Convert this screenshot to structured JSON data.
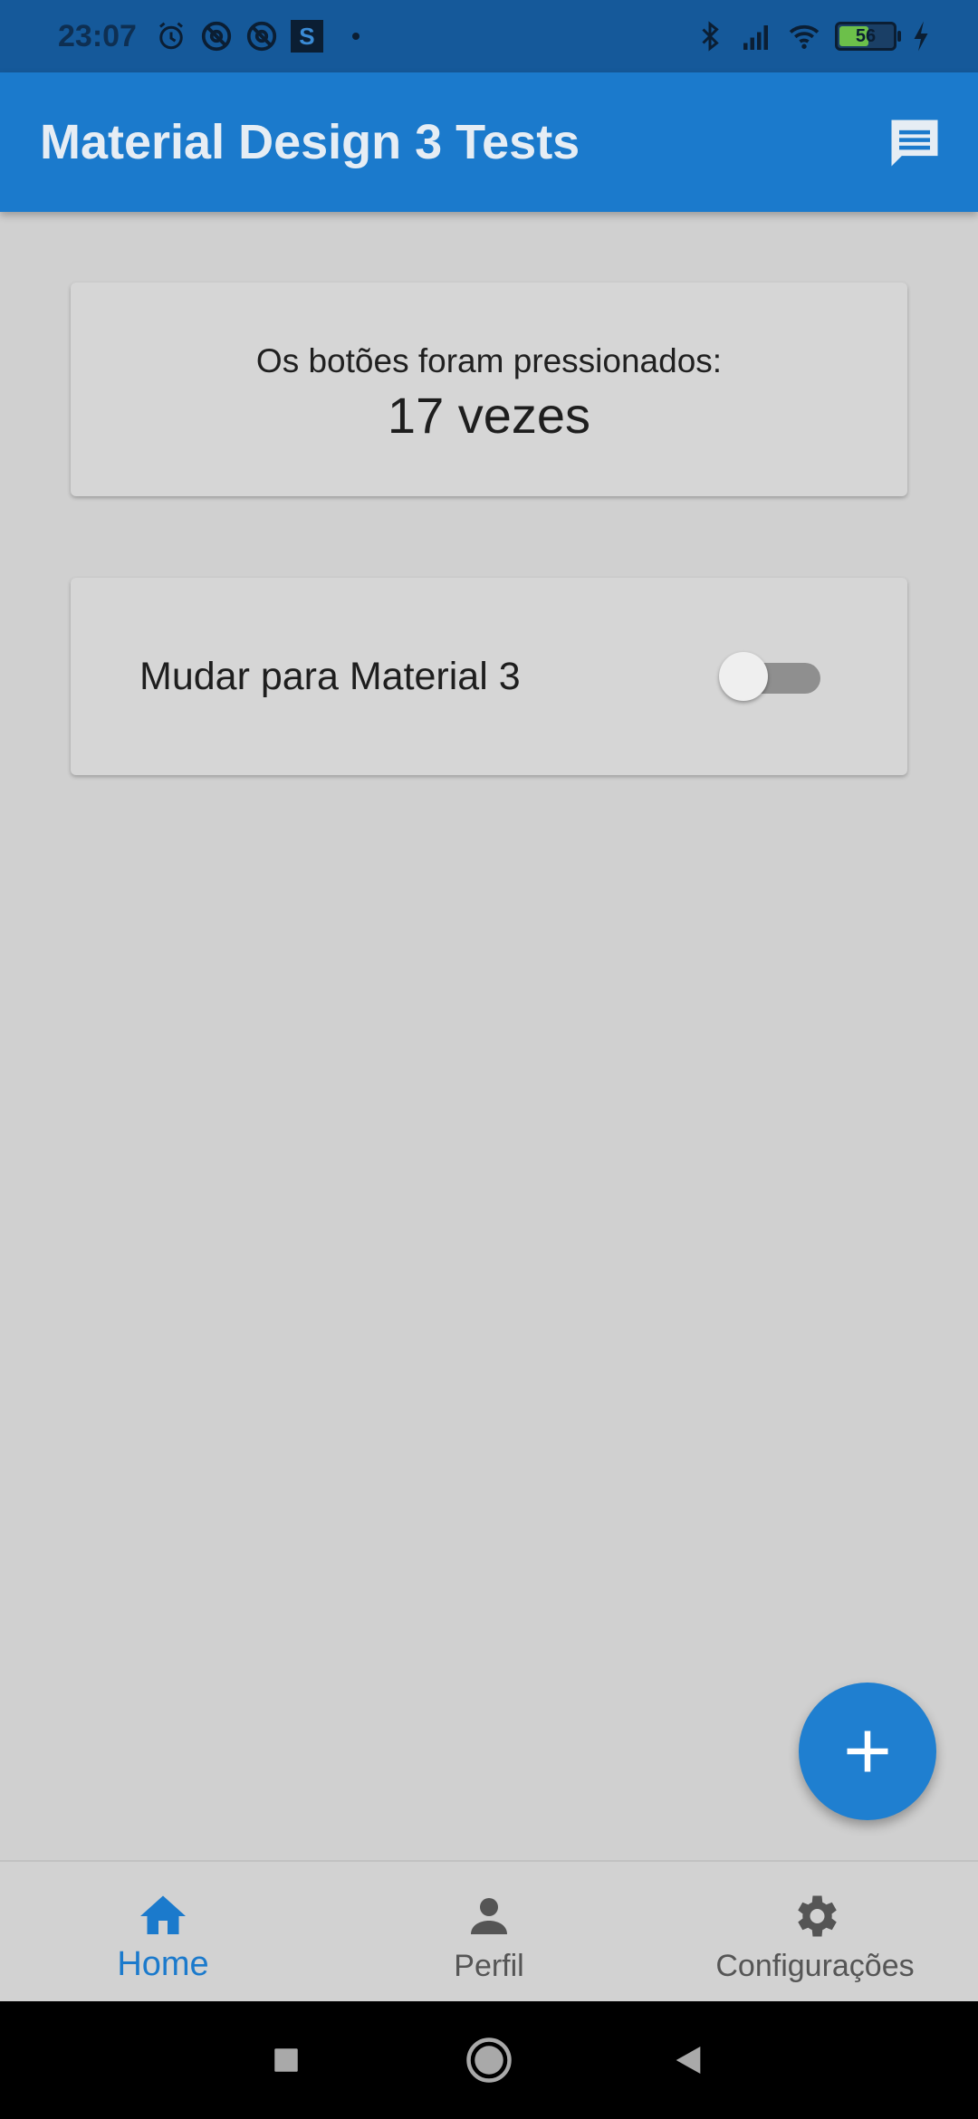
{
  "status_bar": {
    "time": "23:07",
    "left_icons": [
      "alarm-icon",
      "at-sign-icon",
      "at-sign-icon",
      "s-app-icon"
    ],
    "s_badge": "S",
    "right_icons": [
      "bluetooth-icon",
      "signal-icon",
      "wifi-icon",
      "battery-icon",
      "charging-icon"
    ],
    "battery_level": "56",
    "battery_fraction": 0.56
  },
  "app_bar": {
    "title": "Material Design 3 Tests",
    "action_icon": "message-icon"
  },
  "counter_card": {
    "label": "Os botões foram pressionados:",
    "value": "17 vezes"
  },
  "toggle_card": {
    "label": "Mudar para Material 3",
    "switch_on": false
  },
  "fab": {
    "icon": "plus-icon"
  },
  "bottom_nav": {
    "items": [
      {
        "label": "Home",
        "icon": "home-icon",
        "active": true
      },
      {
        "label": "Perfil",
        "icon": "person-icon",
        "active": false
      },
      {
        "label": "Configurações",
        "icon": "gear-icon",
        "active": false
      }
    ]
  },
  "system_nav": [
    "recents-button",
    "home-button",
    "back-button"
  ],
  "colors": {
    "primary": "#1b7acc",
    "status_bar": "#15599a",
    "background": "#d0d0d0"
  }
}
